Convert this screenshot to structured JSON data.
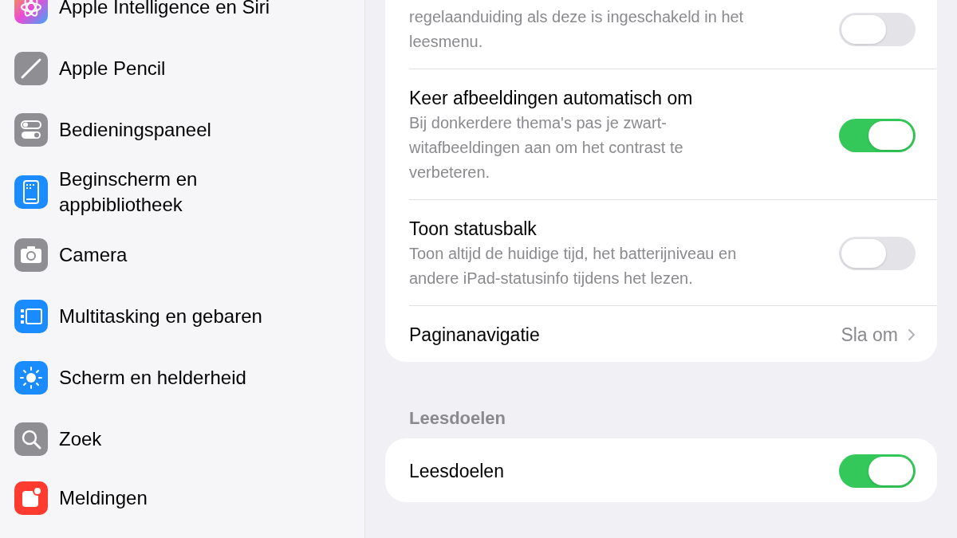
{
  "sidebar": {
    "groups": [
      {
        "items": [
          {
            "label": "Apple Intelligence en Siri"
          },
          {
            "label": "Apple Pencil"
          },
          {
            "label": "Bedieningspaneel"
          },
          {
            "label": "Beginscherm en appbibliotheek"
          },
          {
            "label": "Camera"
          },
          {
            "label": "Multitasking en gebaren"
          },
          {
            "label": "Scherm en helderheid"
          },
          {
            "label": "Zoek"
          }
        ]
      },
      {
        "items": [
          {
            "label": "Meldingen"
          }
        ]
      }
    ]
  },
  "detail": {
    "sections": [
      {
        "rows": [
          {
            "kind": "toggle",
            "description": "regelaanduiding als deze is ingeschakeld in het leesmenu.",
            "on": false
          },
          {
            "kind": "toggle",
            "title": "Keer afbeeldingen automatisch om",
            "description": "Bij donkerdere thema's pas je zwart-witafbeeldingen aan om het contrast te verbeteren.",
            "on": true
          },
          {
            "kind": "toggle",
            "title": "Toon statusbalk",
            "description": "Toon altijd de huidige tijd, het batterijniveau en andere iPad-statusinfo tijdens het lezen.",
            "on": false
          },
          {
            "kind": "link",
            "title": "Paginanavigatie",
            "value": "Sla om"
          }
        ]
      },
      {
        "header": "Leesdoelen",
        "rows": [
          {
            "kind": "toggle",
            "title": "Leesdoelen",
            "on": true
          }
        ]
      }
    ]
  }
}
